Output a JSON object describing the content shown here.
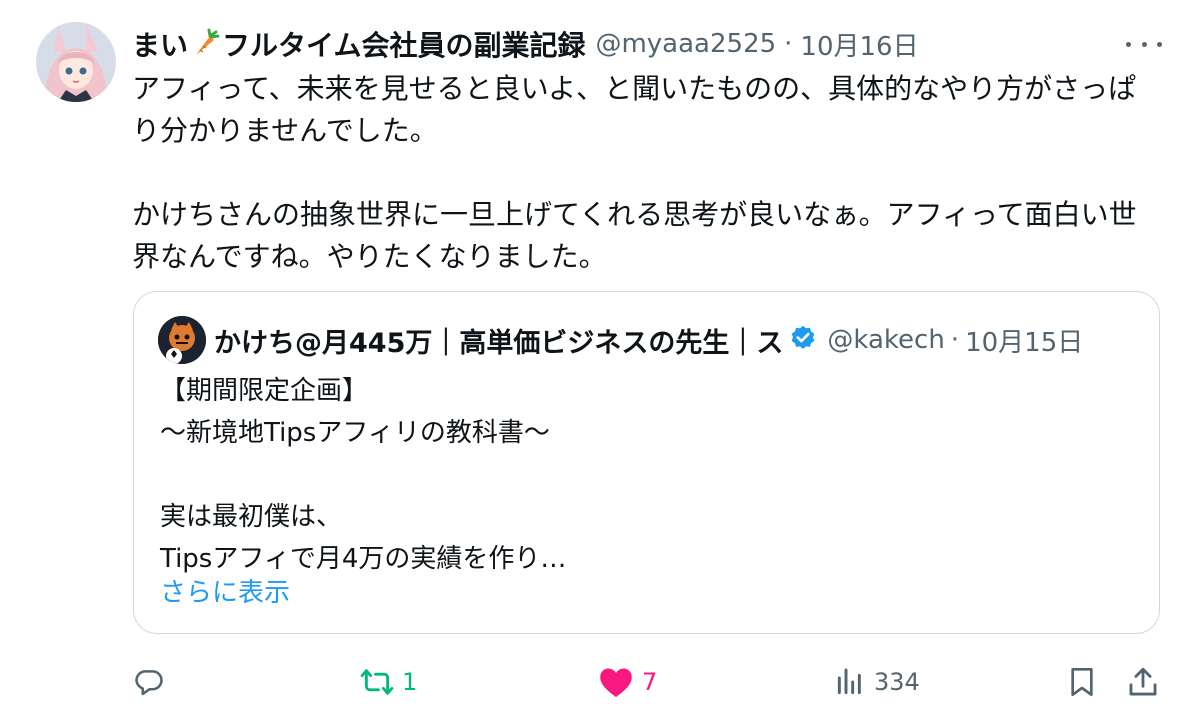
{
  "tweet": {
    "display_name_pre": "まい",
    "display_name_post": "フルタイム会社員の副業記録",
    "handle": "@myaaa2525",
    "separator": "·",
    "date": "10月16日",
    "text": "アフィって、未来を見せると良いよ、と聞いたものの、具体的なやり方がさっぱり分かりませんでした。\n\nかけちさんの抽象世界に一旦上げてくれる思考が良いなぁ。アフィって面白い世界なんですね。やりたくなりました。"
  },
  "quote": {
    "display_name": "かけち@月445万｜高単価ビジネスの先生｜ス",
    "handle": "@kakech",
    "separator": "·",
    "date": "10月15日",
    "text": "【期間限定企画】\n〜新境地Tipsアフィリの教科書〜\n\n実は最初僕は、\nTipsアフィで月4万の実績を作り…",
    "show_more": "さらに表示"
  },
  "actions": {
    "reply_icon": "reply-icon",
    "retweet_icon": "retweet-icon",
    "retweet_count": "1",
    "like_icon": "heart-icon",
    "like_count": "7",
    "views_icon": "views-icon",
    "views_count": "334",
    "bookmark_icon": "bookmark-icon",
    "share_icon": "share-icon"
  },
  "colors": {
    "text": "#0f1419",
    "secondary": "#536471",
    "link": "#1d9bf0",
    "retweet": "#00ba7c",
    "like": "#f91880",
    "border": "#cfd9de"
  }
}
